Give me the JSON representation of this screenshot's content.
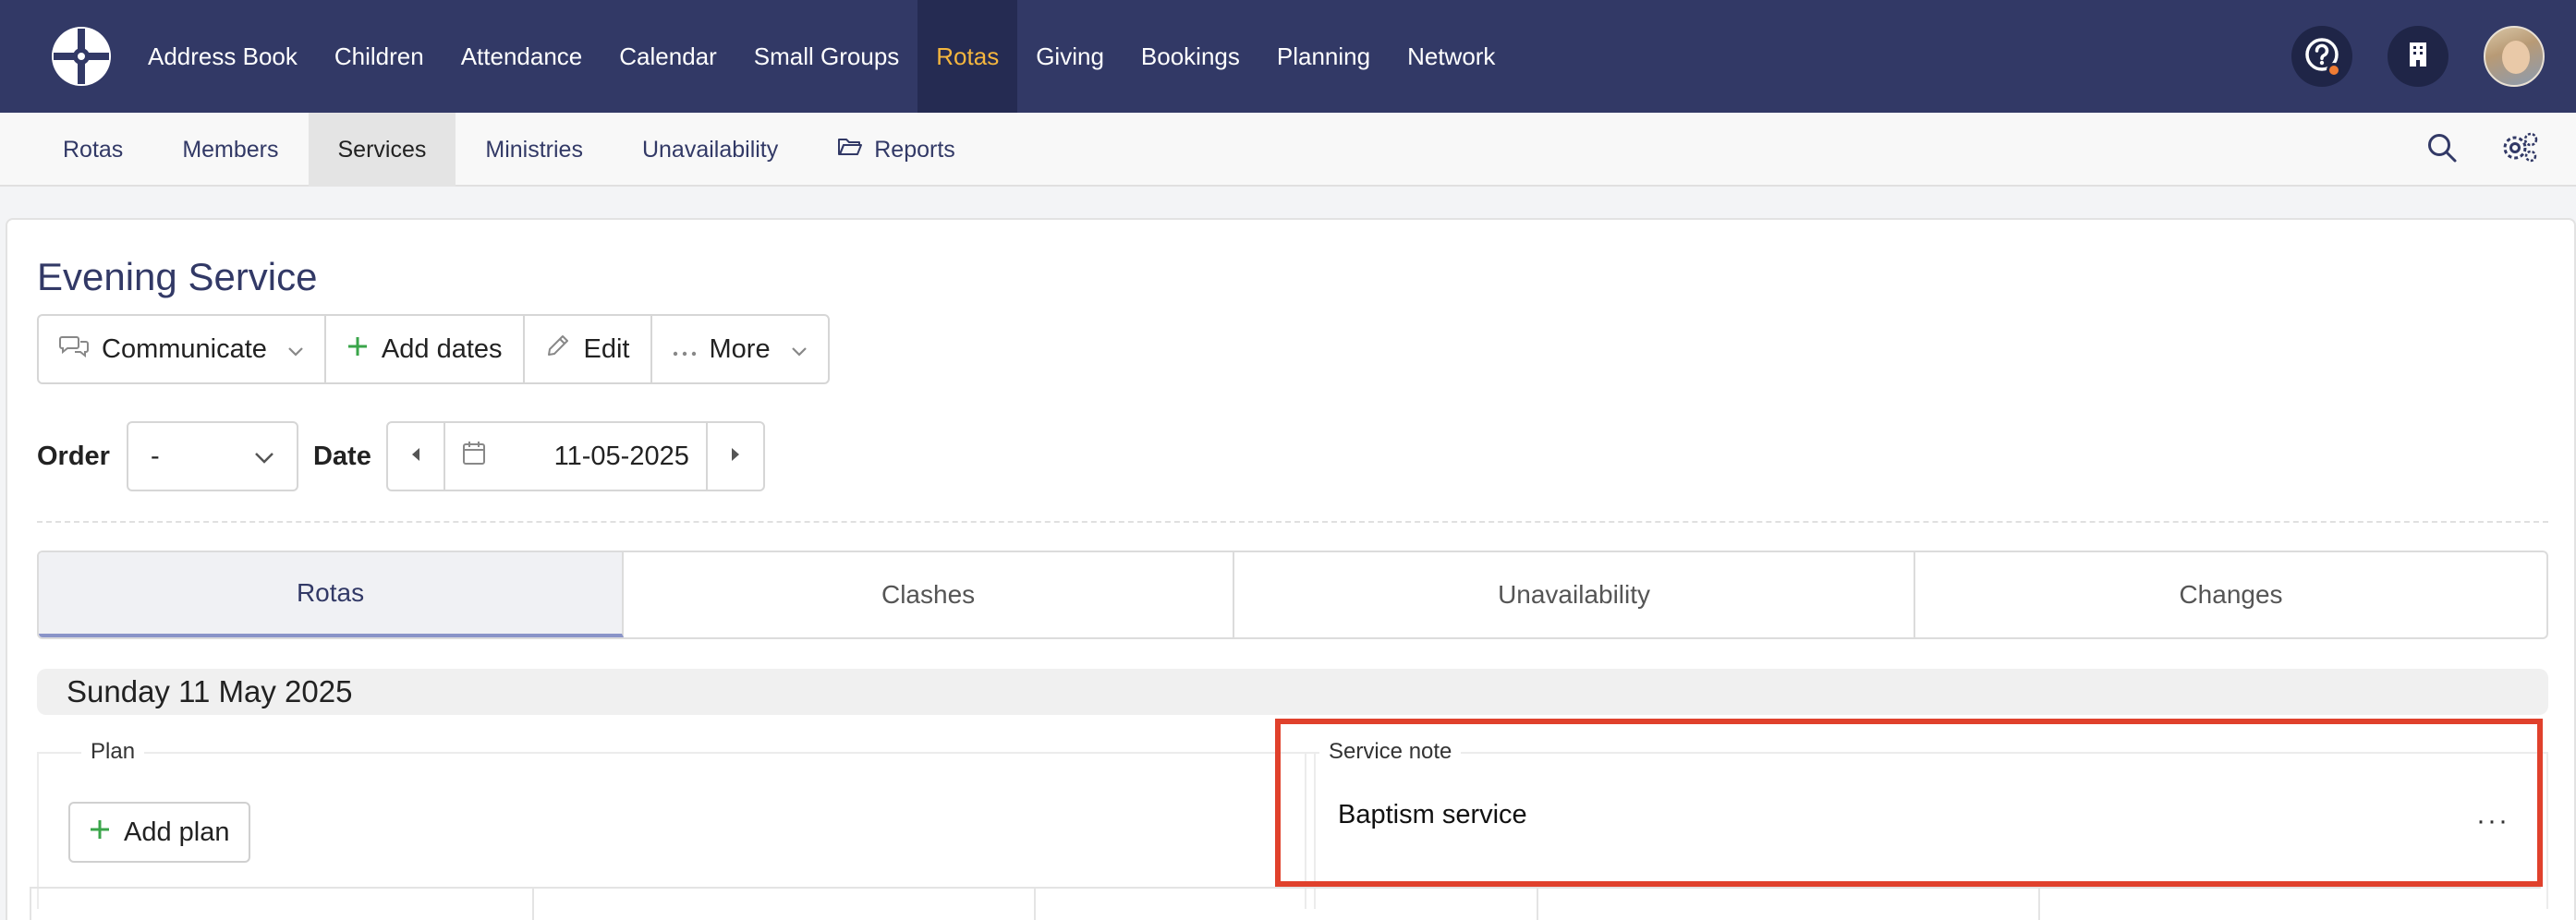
{
  "topnav": {
    "items": [
      {
        "label": "Address Book",
        "active": false
      },
      {
        "label": "Children",
        "active": false
      },
      {
        "label": "Attendance",
        "active": false
      },
      {
        "label": "Calendar",
        "active": false
      },
      {
        "label": "Small Groups",
        "active": false
      },
      {
        "label": "Rotas",
        "active": true
      },
      {
        "label": "Giving",
        "active": false
      },
      {
        "label": "Bookings",
        "active": false
      },
      {
        "label": "Planning",
        "active": false
      },
      {
        "label": "Network",
        "active": false
      }
    ],
    "icons": [
      "logo-icon",
      "help-icon",
      "building-icon",
      "avatar"
    ],
    "accent_color": "#f4b63e",
    "background_color": "#323966"
  },
  "subnav": {
    "items": [
      {
        "label": "Rotas",
        "active": false
      },
      {
        "label": "Members",
        "active": false
      },
      {
        "label": "Services",
        "active": true
      },
      {
        "label": "Ministries",
        "active": false
      },
      {
        "label": "Unavailability",
        "active": false
      },
      {
        "label": "Reports",
        "active": false,
        "icon": "folder-open-icon"
      }
    ],
    "right_icons": [
      "search-icon",
      "settings-icon"
    ]
  },
  "main": {
    "title": "Evening Service",
    "actions": [
      {
        "label": "Communicate",
        "icon": "chat-icon",
        "dropdown": true
      },
      {
        "label": "Add dates",
        "icon": "plus-icon",
        "dropdown": false
      },
      {
        "label": "Edit",
        "icon": "pencil-icon",
        "dropdown": false
      },
      {
        "label": "More",
        "icon": "ellipsis-icon",
        "dropdown": true
      }
    ],
    "filters": {
      "order_label": "Order",
      "order_value": "-",
      "date_label": "Date",
      "date_value": "11-05-2025"
    },
    "tabs": [
      {
        "label": "Rotas",
        "active": true
      },
      {
        "label": "Clashes",
        "active": false
      },
      {
        "label": "Unavailability",
        "active": false
      },
      {
        "label": "Changes",
        "active": false
      }
    ],
    "date_header": "Sunday 11 May 2025",
    "plan": {
      "legend": "Plan",
      "add_button": "Add plan"
    },
    "service_note": {
      "legend": "Service note",
      "text": "Baptism service",
      "more": "···"
    },
    "highlight_color": "#e0412c"
  }
}
